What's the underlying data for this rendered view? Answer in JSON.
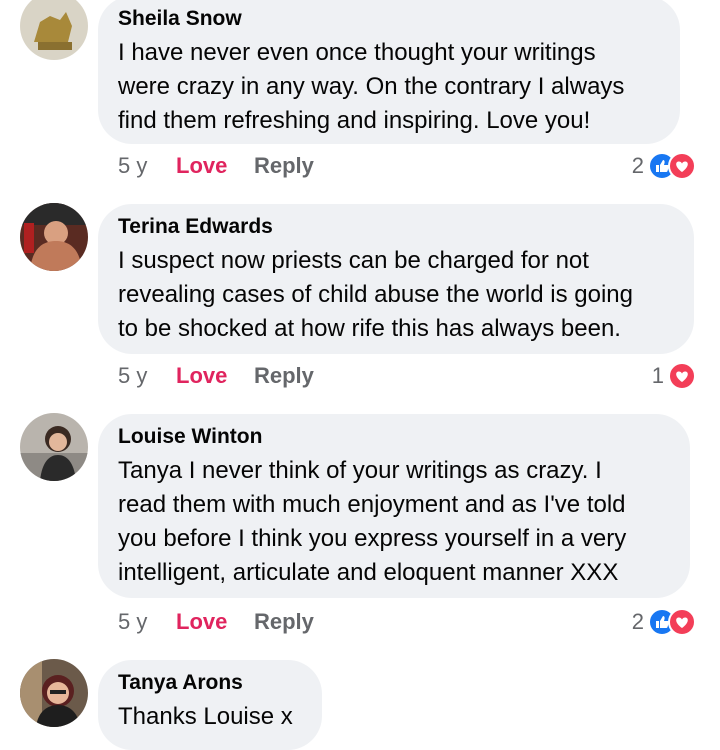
{
  "colors": {
    "love": "#e0245e",
    "like": "#1877f2",
    "heart": "#f33e58",
    "bubble": "#eff1f4",
    "muted": "#65676b"
  },
  "comments": [
    {
      "author": "Sheila Snow",
      "text": "I have never even once thought your writings\nwere crazy in any way. On the contrary I always\nfind them refreshing and inspiring. Love you!",
      "time": "5 y",
      "love_label": "Love",
      "reply_label": "Reply",
      "reaction_count": "2",
      "reactions": [
        "like-icon",
        "heart-icon"
      ]
    },
    {
      "author": "Terina Edwards",
      "text": "I suspect now priests can be charged for not\nrevealing cases of child abuse the world is going\nto be shocked at how rife this has always been.",
      "time": "5 y",
      "love_label": "Love",
      "reply_label": "Reply",
      "reaction_count": "1",
      "reactions": [
        "heart-icon"
      ]
    },
    {
      "author": "Louise Winton",
      "text": "Tanya I never think of your writings as crazy.   I\nread them with much enjoyment and as I've told\nyou before I think you express yourself in a very\nintelligent, articulate and eloquent manner XXX",
      "time": "5 y",
      "love_label": "Love",
      "reply_label": "Reply",
      "reaction_count": "2",
      "reactions": [
        "like-icon",
        "heart-icon"
      ]
    },
    {
      "author": "Tanya Arons",
      "text": "Thanks Louise x"
    }
  ]
}
